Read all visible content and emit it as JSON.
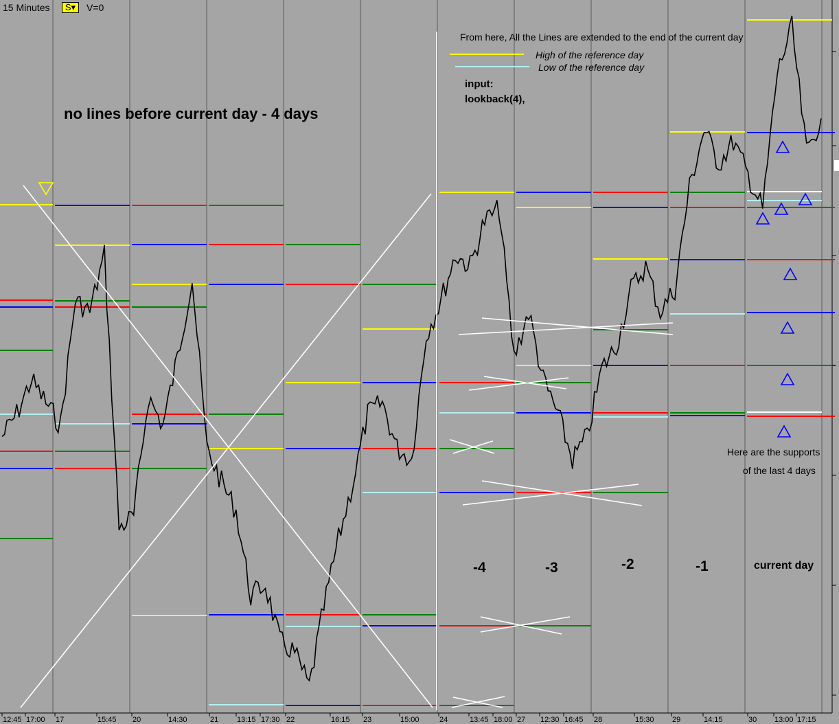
{
  "header": {
    "timeframe": "15 Minutes",
    "style_button": "S▾",
    "volume": "V=0"
  },
  "annotations": {
    "no_lines": "no lines before current day - 4 days",
    "extended": "From here, All the Lines are extended to the end of the current day",
    "legend_high": "High of the reference day",
    "legend_low": "Low of the reference day",
    "input_label": "input:",
    "input_value": "lookback(4),",
    "day_m4": "-4",
    "day_m3": "-3",
    "day_m2": "-2",
    "day_m1": "-1",
    "day_current": "current day",
    "supports_1": "Here are the supports",
    "supports_2": "of the last 4 days"
  },
  "colors": {
    "background": "#a5a5a5",
    "price": "#000000",
    "high": "#ffff00",
    "low": "#b4f0f0",
    "blue": "#0000ff",
    "red": "#ff0000",
    "green": "#008000",
    "separator": "#808080",
    "drawing": "#ffffff",
    "marker": "#0000ff",
    "marker_top": "#ffff00"
  },
  "chart_data": {
    "type": "line",
    "title": "",
    "xlabel": "",
    "ylabel": "",
    "x_ticks": [
      "12:45",
      "17:00",
      "17",
      "15:45",
      "20",
      "14:30",
      "21",
      "13:15",
      "17:30",
      "22",
      "16:15",
      "23",
      "15:00",
      "24",
      "13:45",
      "18:00",
      "27",
      "12:30",
      "16:45",
      "28",
      "15:30",
      "29",
      "14:15",
      "30",
      "13:00",
      "17:15"
    ],
    "y_scale": "price, unlabeled",
    "sessions": [
      "17",
      "20",
      "21",
      "22",
      "23",
      "24",
      "27",
      "28",
      "29",
      "30"
    ],
    "session_markers": [
      "-4",
      "-3",
      "-2",
      "-1",
      "current day"
    ],
    "series": [
      {
        "values": [
          48,
          52,
          58,
          54,
          50,
          72,
          70,
          80,
          32,
          34,
          55,
          50,
          62,
          76,
          46,
          40,
          35,
          20,
          22,
          12,
          10,
          4,
          18,
          30,
          40,
          52,
          54,
          46,
          44,
          66,
          72,
          80,
          78,
          86,
          88,
          62,
          70,
          58,
          52,
          44,
          48,
          60,
          64,
          74,
          78,
          70,
          74,
          92,
          102,
          96,
          100,
          94,
          88,
          112,
          120,
          98,
          104
        ]
      }
    ]
  }
}
